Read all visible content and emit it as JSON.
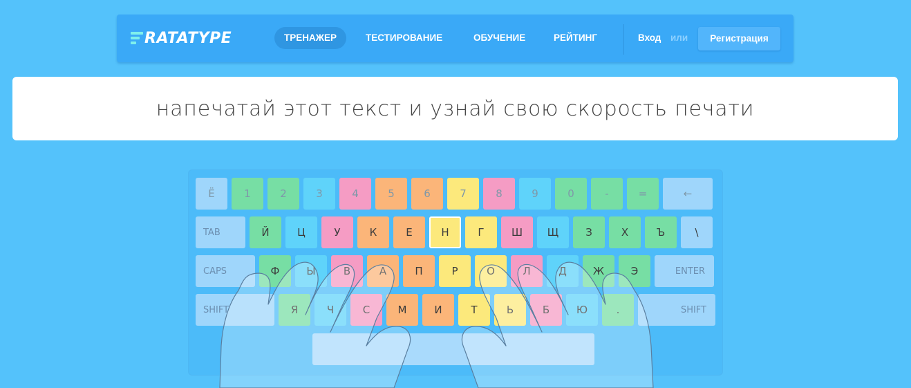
{
  "header": {
    "logo_text": "RATATYPE",
    "nav": [
      "ТРЕНАЖЕР",
      "ТЕСТИРОВАНИЕ",
      "ОБУЧЕНИЕ",
      "РЕЙТИНГ"
    ],
    "active_nav": "ТРЕНАЖЕР",
    "login_label": "Вход",
    "or_label": "или",
    "register_label": "Регистрация"
  },
  "prompt": {
    "text": "напечатай этот текст и узнай свою скорость печати"
  },
  "keyboard": {
    "active_key": "Н",
    "rows": [
      [
        "Ё",
        "1",
        "2",
        "3",
        "4",
        "5",
        "6",
        "7",
        "8",
        "9",
        "0",
        "-",
        "=",
        "←"
      ],
      [
        "TAB",
        "Й",
        "Ц",
        "У",
        "К",
        "Е",
        "Н",
        "Г",
        "Ш",
        "Щ",
        "З",
        "Х",
        "Ъ",
        "\\"
      ],
      [
        "CAPS",
        "Ф",
        "Ы",
        "В",
        "А",
        "П",
        "Р",
        "О",
        "Л",
        "Д",
        "Ж",
        "Э",
        "ENTER"
      ],
      [
        "SHIFT",
        "Я",
        "Ч",
        "С",
        "М",
        "И",
        "Т",
        "Ь",
        "Б",
        "Ю",
        ".",
        "SHIFT"
      ]
    ],
    "colors": {
      "blue": "#9fd6fb",
      "green": "#77dea4",
      "cyan": "#5fd3fa",
      "pink": "#f59cc4",
      "orange": "#fbb579",
      "yellow": "#fce97c"
    }
  }
}
